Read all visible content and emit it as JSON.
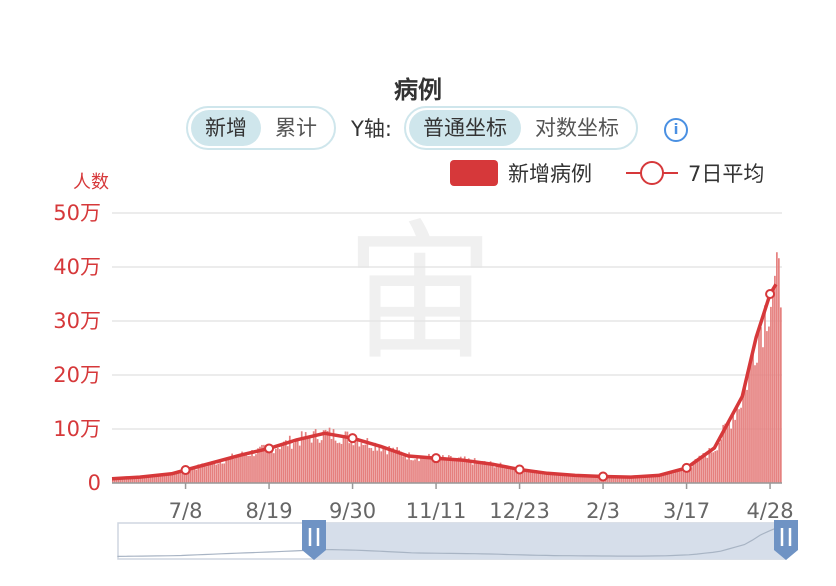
{
  "title": "病例",
  "toggle_mode": {
    "options": [
      "新增",
      "累计"
    ],
    "selected": "新增"
  },
  "yaxis_toggle": {
    "label": "Y轴:",
    "options": [
      "普通坐标",
      "对数坐标"
    ],
    "selected": "普通坐标"
  },
  "info_icon": "i",
  "legend": {
    "bar_label": "新增病例",
    "line_label": "7日平均"
  },
  "watermark": "宙",
  "colors": {
    "bar": "#e57f7e",
    "line": "#d6383a",
    "axis_text": "#d6383a",
    "grid": "#e6e6e6"
  },
  "chart_data": {
    "type": "bar",
    "unit_label": "人数",
    "y_ticks": [
      "0",
      "10万",
      "20万",
      "30万",
      "40万",
      "50万"
    ],
    "ylim": [
      0,
      500000
    ],
    "x_ticks": [
      "7/8",
      "8/19",
      "9/30",
      "11/11",
      "12/23",
      "2/3",
      "3/17",
      "4/28"
    ],
    "series": [
      {
        "name": "新增病例",
        "kind": "bar"
      },
      {
        "name": "7日平均",
        "kind": "line",
        "points": [
          {
            "x": "6/1",
            "y": 8000
          },
          {
            "x": "6/15",
            "y": 11000
          },
          {
            "x": "7/1",
            "y": 17000
          },
          {
            "x": "7/8",
            "y": 24000
          },
          {
            "x": "7/22",
            "y": 38000
          },
          {
            "x": "8/5",
            "y": 52000
          },
          {
            "x": "8/19",
            "y": 64000
          },
          {
            "x": "9/2",
            "y": 80000
          },
          {
            "x": "9/16",
            "y": 92000
          },
          {
            "x": "9/30",
            "y": 83000
          },
          {
            "x": "10/14",
            "y": 68000
          },
          {
            "x": "10/28",
            "y": 50000
          },
          {
            "x": "11/11",
            "y": 46000
          },
          {
            "x": "11/25",
            "y": 42000
          },
          {
            "x": "12/9",
            "y": 35000
          },
          {
            "x": "12/23",
            "y": 25000
          },
          {
            "x": "1/6",
            "y": 18000
          },
          {
            "x": "1/20",
            "y": 14000
          },
          {
            "x": "2/3",
            "y": 12000
          },
          {
            "x": "2/17",
            "y": 11000
          },
          {
            "x": "3/3",
            "y": 14000
          },
          {
            "x": "3/17",
            "y": 28000
          },
          {
            "x": "3/31",
            "y": 65000
          },
          {
            "x": "4/14",
            "y": 160000
          },
          {
            "x": "4/21",
            "y": 270000
          },
          {
            "x": "4/28",
            "y": 350000
          },
          {
            "x": "5/1",
            "y": 368000
          }
        ]
      }
    ],
    "markers": [
      24000,
      64000,
      83000,
      46000,
      25000,
      12000,
      28000,
      350000
    ]
  }
}
